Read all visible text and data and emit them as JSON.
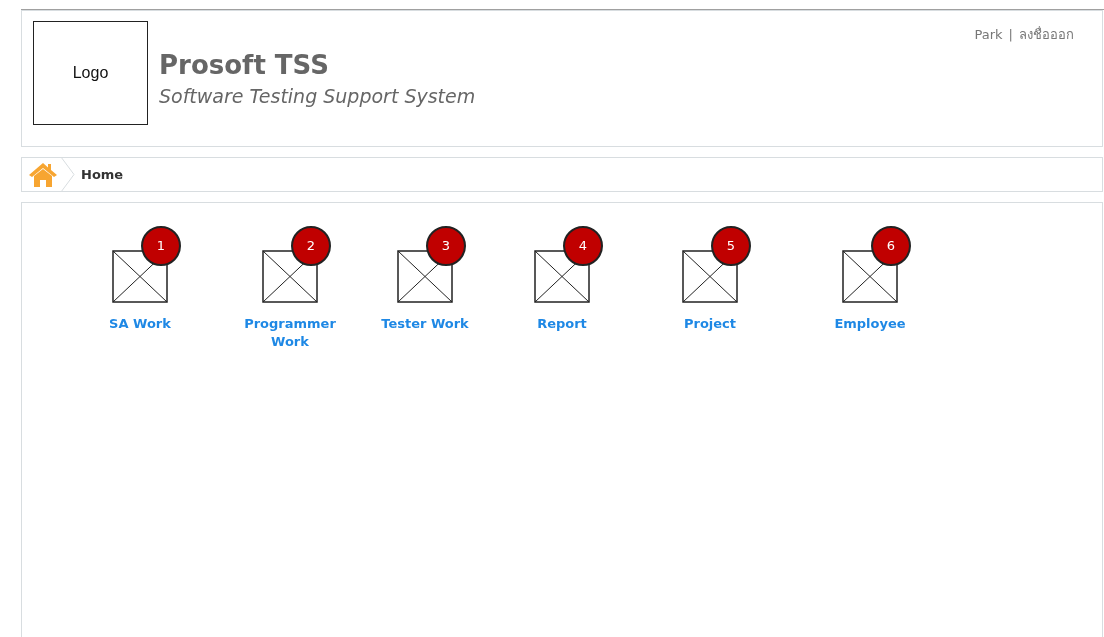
{
  "header": {
    "logo": "Logo",
    "title": "Prosoft TSS",
    "subtitle": "Software Testing Support System",
    "user": "Park",
    "separator": "|",
    "logout": "ลงชื่อออก"
  },
  "breadcrumb": [
    {
      "label": "Home"
    }
  ],
  "menu": [
    {
      "label": "SA Work",
      "badge": "1"
    },
    {
      "label": "Programmer Work",
      "badge": "2"
    },
    {
      "label": "Tester Work",
      "badge": "3"
    },
    {
      "label": "Report",
      "badge": "4"
    },
    {
      "label": "Project",
      "badge": "5"
    },
    {
      "label": "Employee",
      "badge": "6"
    }
  ]
}
